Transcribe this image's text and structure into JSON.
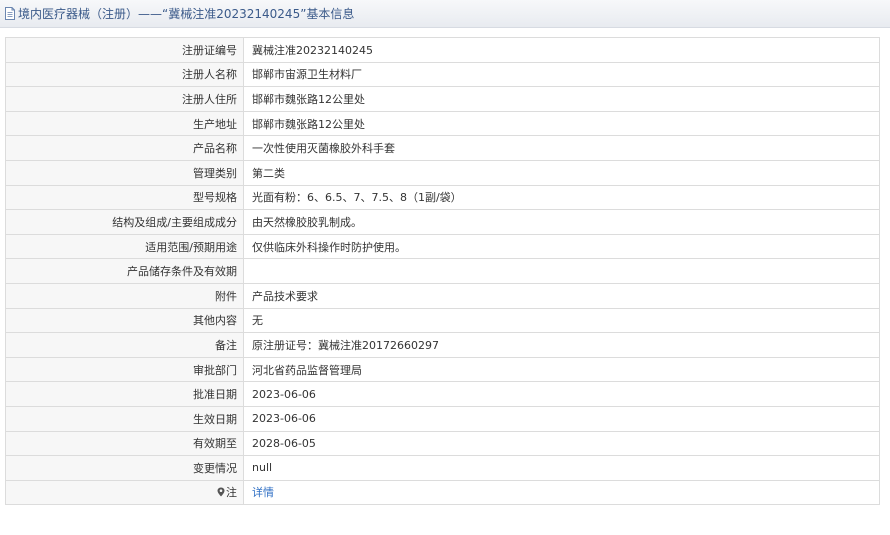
{
  "header": {
    "title": "境内医疗器械（注册）——“冀械注准20232140245”基本信息"
  },
  "rows": [
    {
      "label": "注册证编号",
      "value": "冀械注准20232140245"
    },
    {
      "label": "注册人名称",
      "value": "邯郸市宙源卫生材料厂"
    },
    {
      "label": "注册人住所",
      "value": "邯郸市魏张路12公里处"
    },
    {
      "label": "生产地址",
      "value": "邯郸市魏张路12公里处"
    },
    {
      "label": "产品名称",
      "value": "一次性使用灭菌橡胶外科手套"
    },
    {
      "label": "管理类别",
      "value": "第二类"
    },
    {
      "label": "型号规格",
      "value": "光面有粉：6、6.5、7、7.5、8（1副/袋）"
    },
    {
      "label": "结构及组成/主要组成成分",
      "value": "由天然橡胶胶乳制成。"
    },
    {
      "label": "适用范围/预期用途",
      "value": "仅供临床外科操作时防护使用。"
    },
    {
      "label": "产品储存条件及有效期",
      "value": ""
    },
    {
      "label": "附件",
      "value": "产品技术要求"
    },
    {
      "label": "其他内容",
      "value": "无"
    },
    {
      "label": "备注",
      "value": "原注册证号：冀械注准20172660297"
    },
    {
      "label": "审批部门",
      "value": "河北省药品监督管理局"
    },
    {
      "label": "批准日期",
      "value": "2023-06-06"
    },
    {
      "label": "生效日期",
      "value": "2023-06-06"
    },
    {
      "label": "有效期至",
      "value": "2028-06-05"
    },
    {
      "label": "变更情况",
      "value": "null"
    }
  ],
  "note_row": {
    "label": "注",
    "icon": "pin-icon",
    "link_text": "详情"
  }
}
